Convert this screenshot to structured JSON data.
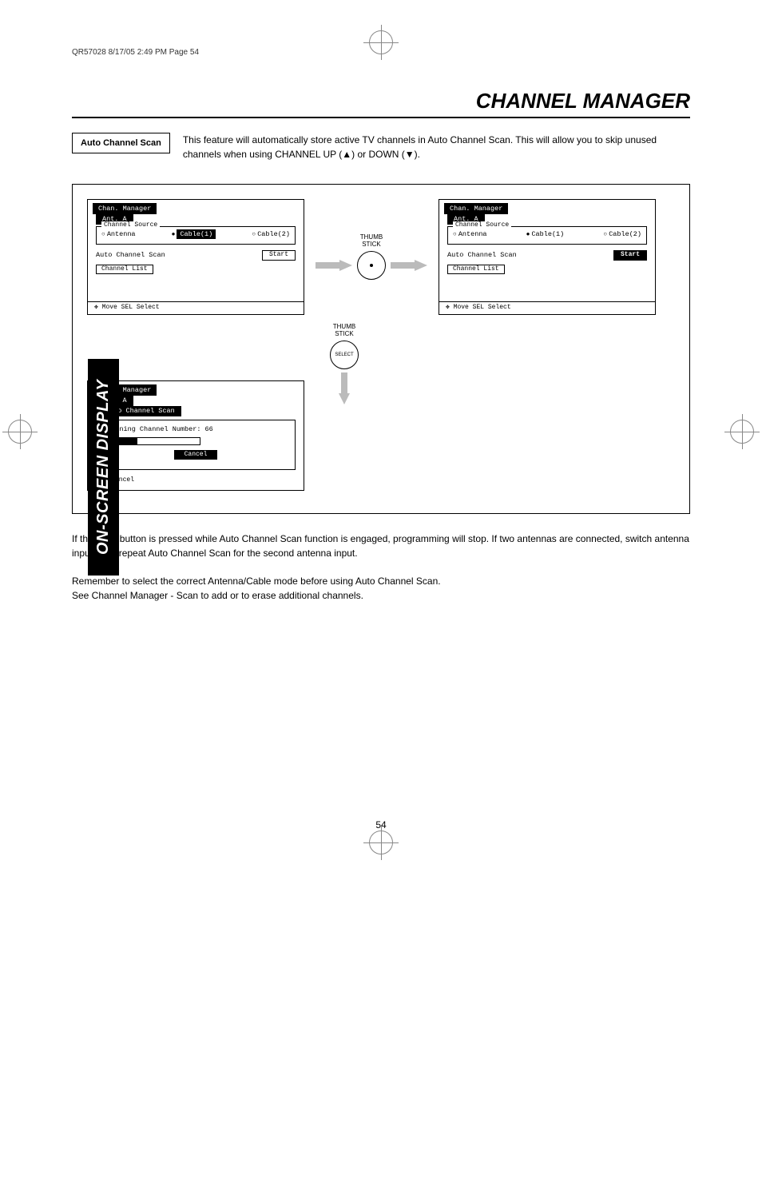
{
  "header_info": "QR57028  8/17/05  2:49 PM  Page 54",
  "page_title": "CHANNEL MANAGER",
  "section_label": "Auto Channel Scan",
  "intro_text": "This feature will automatically store active TV channels in Auto Channel Scan.  This will allow you to skip unused channels when using CHANNEL UP (▲) or DOWN (▼).",
  "menu1": {
    "title": "Chan. Manager",
    "tab": "Ant. A",
    "fieldset_legend": "Channel Source",
    "src": {
      "antenna": "Antenna",
      "cable1": "Cable(1)",
      "cable2": "Cable(2)"
    },
    "auto_scan": "Auto Channel Scan",
    "start": "Start",
    "ch_list": "Channel List",
    "footer": "Move SEL Select",
    "footer_glyph": "✥"
  },
  "thumb_label": "THUMB\nSTICK",
  "select_label": "SELECT",
  "menu2": {
    "title": "Chan. Manager",
    "tab": "Ant. A",
    "fieldset_legend": "Channel Source",
    "src": {
      "antenna": "Antenna",
      "cable1": "Cable(1)",
      "cable2": "Cable(2)"
    },
    "auto_scan": "Auto Channel Scan",
    "start": "Start",
    "ch_list": "Channel List",
    "footer": "Move SEL Select",
    "footer_glyph": "✥"
  },
  "menu3": {
    "title": "Chan. Manager",
    "tab": "Ant. A",
    "box_title": "Auto Channel Scan",
    "scanning": "Scanning Channel Number: 66",
    "cancel": "Cancel",
    "footer": "SEL Cancel"
  },
  "para1": "If the EXIT button is pressed while Auto Channel Scan function is engaged, programming will stop.  If two antennas are connected, switch antenna inputs and repeat Auto Channel Scan for the second antenna input.",
  "para2a": "Remember to select the correct Antenna/Cable mode before using Auto Channel Scan.",
  "para2b": "See Channel Manager - Scan to add or to erase additional channels.",
  "sidebar": "ON-SCREEN DISPLAY",
  "page_number": "54"
}
